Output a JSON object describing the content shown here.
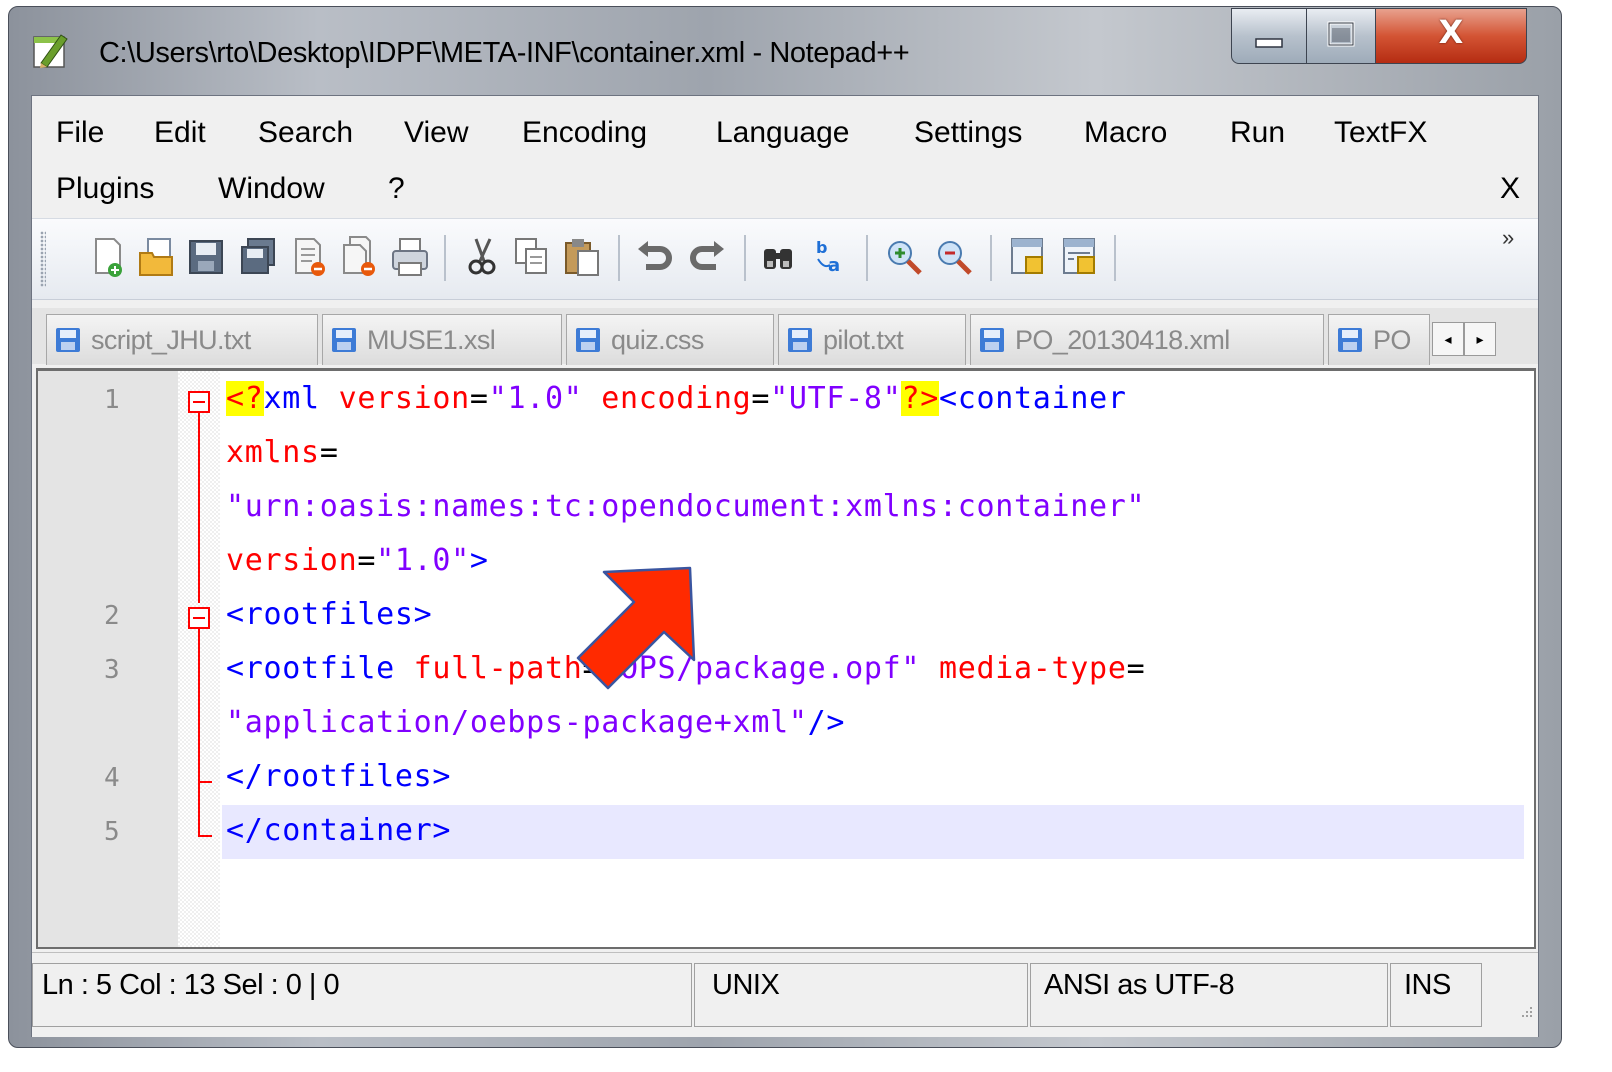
{
  "window": {
    "title": "C:\\Users\\rto\\Desktop\\IDPF\\META-INF\\container.xml - Notepad++",
    "minimize_icon": "minimize-icon",
    "maximize_icon": "maximize-icon",
    "close_icon": "close-icon",
    "close_glyph": "X"
  },
  "menu": {
    "row1": [
      {
        "label": "File"
      },
      {
        "label": "Edit"
      },
      {
        "label": "Search"
      },
      {
        "label": "View"
      },
      {
        "label": "Encoding"
      },
      {
        "label": "Language"
      },
      {
        "label": "Settings"
      },
      {
        "label": "Macro"
      },
      {
        "label": "Run"
      },
      {
        "label": "TextFX"
      }
    ],
    "row2": [
      {
        "label": "Plugins"
      },
      {
        "label": "Window"
      },
      {
        "label": "?"
      }
    ],
    "close_label": "X"
  },
  "toolbar": {
    "icons": [
      "new-file-icon",
      "open-file-icon",
      "save-icon",
      "save-all-icon",
      "close-file-icon",
      "close-all-icon",
      "print-icon",
      "cut-icon",
      "copy-icon",
      "paste-icon",
      "undo-icon",
      "redo-icon",
      "find-icon",
      "replace-icon",
      "zoom-in-icon",
      "zoom-out-icon",
      "sync-vertical-icon",
      "sync-horizontal-icon"
    ],
    "overflow_label": "»"
  },
  "tabs": [
    {
      "label": "script_JHU.txt"
    },
    {
      "label": "MUSE1.xsl"
    },
    {
      "label": "quiz.css"
    },
    {
      "label": "pilot.txt"
    },
    {
      "label": "PO_20130418.xml"
    },
    {
      "label": "PO"
    }
  ],
  "tab_scroll": {
    "left": "◂",
    "right": "▸"
  },
  "editor": {
    "line_numbers": [
      "1",
      "2",
      "3",
      "4",
      "5"
    ],
    "current_line": 5,
    "lines": [
      [
        {
          "t": "<?",
          "c": "hl"
        },
        {
          "t": "xml ",
          "c": "blue"
        },
        {
          "t": "version",
          "c": "red"
        },
        {
          "t": "=",
          "c": "black"
        },
        {
          "t": "\"1.0\"",
          "c": "purple"
        },
        {
          "t": " encoding",
          "c": "red"
        },
        {
          "t": "=",
          "c": "black"
        },
        {
          "t": "\"UTF-8\"",
          "c": "purple"
        },
        {
          "t": "?>",
          "c": "hl"
        },
        {
          "t": "<container",
          "c": "blue"
        }
      ],
      [
        {
          "t": "xmlns",
          "c": "red"
        },
        {
          "t": "=",
          "c": "black"
        }
      ],
      [
        {
          "t": "\"urn:oasis:names:tc:opendocument:xmlns:container\"",
          "c": "purple"
        }
      ],
      [
        {
          "t": "version",
          "c": "red"
        },
        {
          "t": "=",
          "c": "black"
        },
        {
          "t": "\"1.0\"",
          "c": "purple"
        },
        {
          "t": ">",
          "c": "blue"
        }
      ],
      [
        {
          "t": "<rootfiles>",
          "c": "blue"
        }
      ],
      [
        {
          "t": "<rootfile ",
          "c": "blue"
        },
        {
          "t": "full-path",
          "c": "red"
        },
        {
          "t": "=",
          "c": "black"
        },
        {
          "t": "\"OPS/package.opf\"",
          "c": "purple"
        },
        {
          "t": " media-type",
          "c": "red"
        },
        {
          "t": "=",
          "c": "black"
        }
      ],
      [
        {
          "t": "\"application/oebps-package+xml\"",
          "c": "purple"
        },
        {
          "t": "/>",
          "c": "blue"
        }
      ],
      [
        {
          "t": "</rootfiles>",
          "c": "blue"
        }
      ],
      [
        {
          "t": "</container>",
          "c": "blue"
        }
      ]
    ]
  },
  "annotation": {
    "icon": "red-arrow-icon",
    "color": "#ff2a00"
  },
  "statusbar": {
    "position": "Ln : 5    Col : 13    Sel : 0 | 0",
    "eol": "UNIX",
    "encoding": "ANSI as UTF-8",
    "mode": "INS"
  },
  "colors": {
    "tag": "#0000ff",
    "attribute": "#ff0000",
    "value": "#8000ff",
    "highlight": "#ffff00",
    "current_line": "#e8e8ff"
  }
}
